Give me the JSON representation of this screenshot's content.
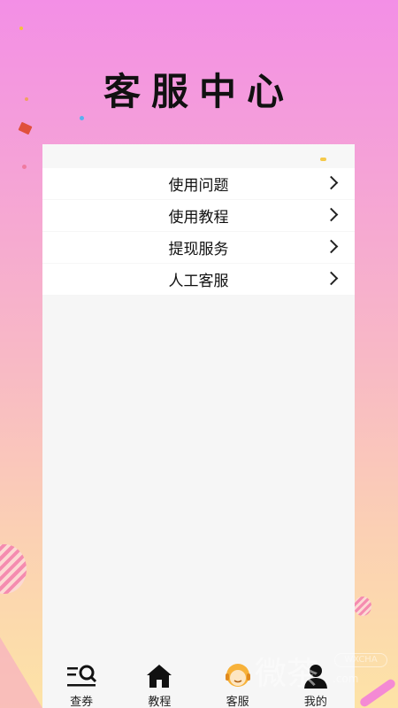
{
  "header": {
    "title": "客服中心"
  },
  "menu": {
    "items": [
      {
        "label": "使用问题"
      },
      {
        "label": "使用教程"
      },
      {
        "label": "提现服务"
      },
      {
        "label": "人工客服"
      }
    ]
  },
  "tabbar": {
    "items": [
      {
        "label": "查券",
        "icon": "search-list-icon"
      },
      {
        "label": "教程",
        "icon": "home-icon"
      },
      {
        "label": "客服",
        "icon": "customer-service-icon"
      },
      {
        "label": "我的",
        "icon": "user-icon"
      }
    ]
  },
  "watermark": {
    "text": "微茶",
    "badge": "WXCHA",
    "url": ".com"
  },
  "colors": {
    "gradient_top": "#f38fe6",
    "gradient_bottom": "#fde3a6",
    "panel": "#f6f6f6"
  }
}
